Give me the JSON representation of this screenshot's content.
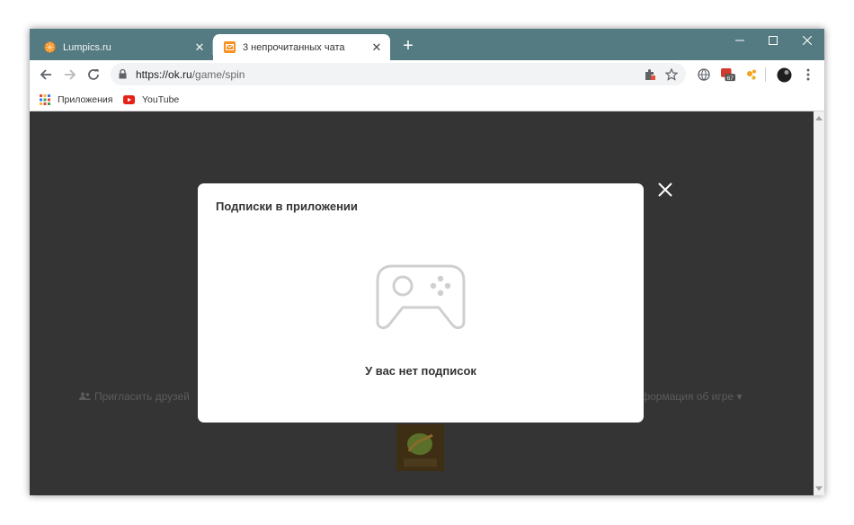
{
  "browser": {
    "tabs": [
      {
        "title": "Lumpics.ru",
        "icon": "orange-favicon",
        "active": false
      },
      {
        "title": "3 непрочитанных чата",
        "icon": "mail-favicon",
        "active": true
      }
    ],
    "new_tab_label": "+",
    "address": {
      "host": "https://ok.ru",
      "path": "/game/spin"
    },
    "bookmarks": [
      {
        "label": "Приложения",
        "icon": "apps-grid-icon"
      },
      {
        "label": "YouTube",
        "icon": "youtube-icon"
      }
    ],
    "extension_badge": "67",
    "colors": {
      "tabstrip": "#547a82",
      "page_bg": "#343434",
      "accent_orange": "#f6901e"
    }
  },
  "page": {
    "invite_friends": "Пригласить друзей",
    "game_info": "Информация об игре ▾"
  },
  "modal": {
    "title": "Подписки в приложении",
    "empty_message": "У вас нет подписок",
    "icon": "gamepad-icon"
  }
}
